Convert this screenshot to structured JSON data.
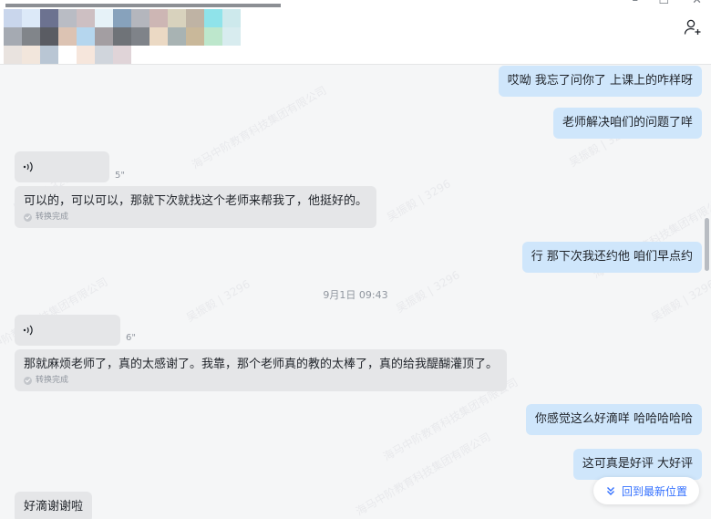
{
  "window": {
    "minimize_glyph": "–",
    "maximize_glyph": "☐",
    "close_glyph": "✕"
  },
  "header": {
    "avatar_mosaic_colors": [
      "#c9d6ec",
      "#dce9f8",
      "#6c7290",
      "#b9bcc4",
      "#cdbfc2",
      "#e6f2f8",
      "#87a2bc",
      "#b4b6bd",
      "#cdb6b4",
      "#d8d2bd",
      "#bfb3a4",
      "#8fe3ea",
      "#cde9ec",
      "#a5aab2",
      "#81858a",
      "#5a5c63",
      "#dcc3b3",
      "#b5d6ee",
      "#a39ea2",
      "#6f7378",
      "#7f8389",
      "#ebd9c4",
      "#a8b3b3",
      "#c9b89a",
      "#bde7cc",
      "#d8ecef",
      "#e9e3df",
      "#f2e6dc",
      "#b9c6d4",
      "#ffffff",
      "#f6e6dc",
      "#d0d5dc",
      "#e0d4d8"
    ],
    "add_member_icon": "add-user-icon"
  },
  "messages": [
    {
      "id": "m1",
      "direction": "out",
      "text": "哎呦 我忘了问你了 上课上的咋样呀"
    },
    {
      "id": "m2",
      "direction": "out",
      "text": "老师解决咱们的问题了咩"
    },
    {
      "id": "m3",
      "direction": "in",
      "type": "voice",
      "duration": "5\"",
      "transcript": "可以的，可以可以，那就下次就找这个老师来帮我了，他挺好的。",
      "status": "转换完成"
    },
    {
      "id": "m4",
      "direction": "out",
      "text": "行 那下次我还约他 咱们早点约"
    },
    {
      "id": "m5",
      "direction": "in",
      "type": "voice",
      "duration": "6\"",
      "transcript": "那就麻烦老师了，真的太感谢了。我靠，那个老师真的教的太棒了，真的给我醍醐灌顶了。",
      "status": "转换完成"
    },
    {
      "id": "m6",
      "direction": "out",
      "text": "你感觉这么好滴咩 哈哈哈哈哈"
    },
    {
      "id": "m7",
      "direction": "out",
      "text": "这可真是好评 大好评"
    },
    {
      "id": "m8",
      "direction": "in",
      "text": "好滴谢谢啦"
    }
  ],
  "timestamp": "9月1日 09:43",
  "jump_to_latest": {
    "label": "回到最新位置"
  },
  "watermarks": [
    "吴振毅 | 3296",
    "海马中阶教育科技集团有限公司"
  ],
  "colors": {
    "accent": "#3370ff",
    "outgoing_bubble": "#cfe6fb",
    "incoming_bubble": "#e5e6e8"
  }
}
